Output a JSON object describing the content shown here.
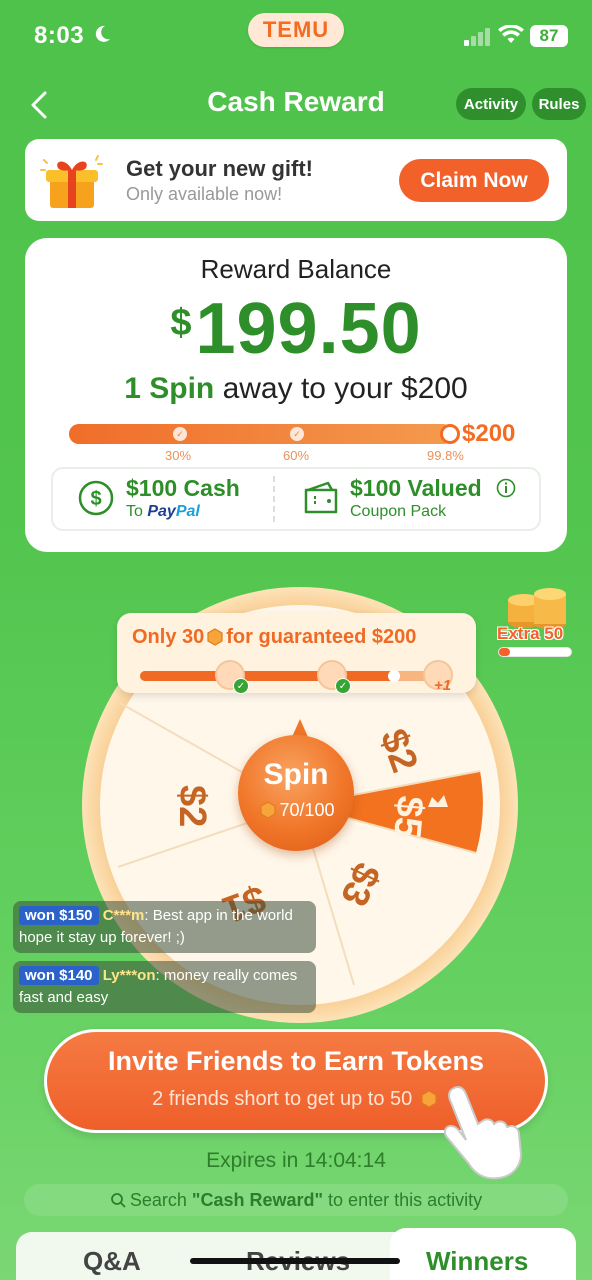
{
  "status_bar": {
    "time": "8:03",
    "battery": "87"
  },
  "app_pill": "TEMU",
  "header": {
    "title": "Cash Reward",
    "activity": "Activity",
    "rules": "Rules"
  },
  "gift_banner": {
    "title": "Get your new gift!",
    "subtitle": "Only available now!",
    "button": "Claim Now"
  },
  "balance": {
    "label": "Reward Balance",
    "currency": "$",
    "amount": "199.50",
    "spin_count": "1 Spin",
    "spin_rest": " away to your $200",
    "progress": 0.998,
    "milestones": [
      "30%",
      "60%",
      "99.8%"
    ],
    "target": "$200"
  },
  "rewards": {
    "cash_title": "$100 Cash",
    "cash_to": "To ",
    "paypal_pay": "Pay",
    "paypal_pal": "Pal",
    "coupon_title": "$100 Valued",
    "coupon_sub": "Coupon Pack"
  },
  "guarantee": {
    "prefix": "Only 30",
    "suffix": "for guaranteed $200",
    "plus": "+1",
    "progress": 0.85
  },
  "extra": {
    "label": "Extra 50",
    "progress": 0.15
  },
  "wheel": {
    "segments": [
      "$2",
      "$2",
      "$5",
      "$3",
      "$1"
    ],
    "spin_label": "Spin",
    "tokens": "70/100"
  },
  "feed": [
    {
      "badge": "won $150",
      "user": "C***m",
      "message": ": Best app in the world hope it stay up forever! ;)"
    },
    {
      "badge": "won $140",
      "user": "Ly***on",
      "message": ": money really comes fast and easy"
    }
  ],
  "invite": {
    "title": "Invite Friends to Earn Tokens",
    "subtitle": "2 friends short to get up to 50"
  },
  "expires": "Expires in 14:04:14",
  "search_hint": {
    "prefix": "Search ",
    "keyword": "\"Cash Reward\"",
    "suffix": " to enter this activity"
  },
  "tabs": {
    "qa": "Q&A",
    "reviews": "Reviews",
    "winners": "Winners"
  },
  "colors": {
    "brand_green": "#2e8f2a",
    "accent_orange": "#f2612a",
    "background_green": "#52c54e"
  }
}
